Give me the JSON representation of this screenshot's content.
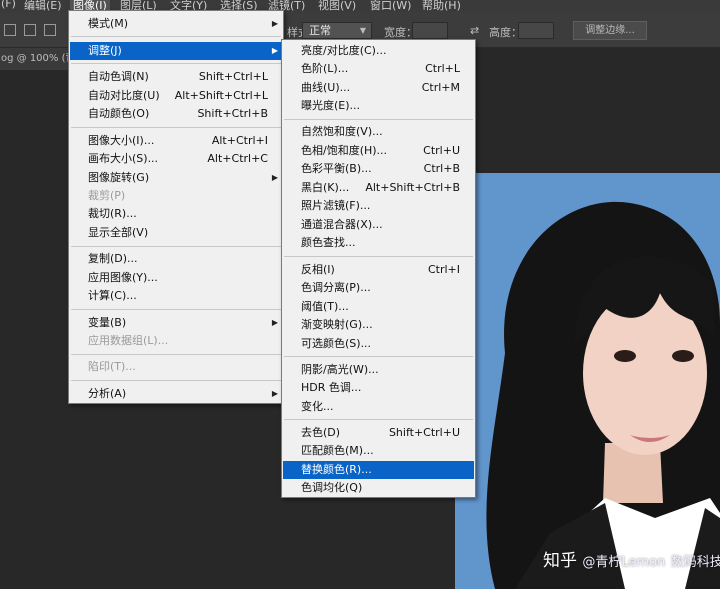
{
  "menubar": {
    "items": [
      "(F)",
      "编辑(E)",
      "图像(I)",
      "图层(L)",
      "文字(Y)",
      "选择(S)",
      "滤镜(T)",
      "视图(V)",
      "窗口(W)",
      "帮助(H)"
    ]
  },
  "options_bar": {
    "style_label": "样式：",
    "style_value": "正常",
    "width_label": "宽度：",
    "height_label": "高度：",
    "refine_edge": "调整边缘..."
  },
  "doc_tab": {
    "title": "og @ 100% (背"
  },
  "main_menu": {
    "items": [
      {
        "label": "模式(M)",
        "shortcut": "",
        "submenu": true,
        "disabled": false,
        "selected": false
      },
      {
        "label": "调整(J)",
        "shortcut": "",
        "submenu": true,
        "disabled": false,
        "selected": true
      },
      {
        "label": "自动色调(N)",
        "shortcut": "Shift+Ctrl+L",
        "submenu": false,
        "disabled": false,
        "selected": false
      },
      {
        "label": "自动对比度(U)",
        "shortcut": "Alt+Shift+Ctrl+L",
        "submenu": false,
        "disabled": false,
        "selected": false
      },
      {
        "label": "自动颜色(O)",
        "shortcut": "Shift+Ctrl+B",
        "submenu": false,
        "disabled": false,
        "selected": false
      },
      {
        "label": "图像大小(I)...",
        "shortcut": "Alt+Ctrl+I",
        "submenu": false,
        "disabled": false,
        "selected": false
      },
      {
        "label": "画布大小(S)...",
        "shortcut": "Alt+Ctrl+C",
        "submenu": false,
        "disabled": false,
        "selected": false
      },
      {
        "label": "图像旋转(G)",
        "shortcut": "",
        "submenu": true,
        "disabled": false,
        "selected": false
      },
      {
        "label": "裁剪(P)",
        "shortcut": "",
        "submenu": false,
        "disabled": true,
        "selected": false
      },
      {
        "label": "裁切(R)...",
        "shortcut": "",
        "submenu": false,
        "disabled": false,
        "selected": false
      },
      {
        "label": "显示全部(V)",
        "shortcut": "",
        "submenu": false,
        "disabled": false,
        "selected": false
      },
      {
        "label": "复制(D)...",
        "shortcut": "",
        "submenu": false,
        "disabled": false,
        "selected": false
      },
      {
        "label": "应用图像(Y)...",
        "shortcut": "",
        "submenu": false,
        "disabled": false,
        "selected": false
      },
      {
        "label": "计算(C)...",
        "shortcut": "",
        "submenu": false,
        "disabled": false,
        "selected": false
      },
      {
        "label": "变量(B)",
        "shortcut": "",
        "submenu": true,
        "disabled": false,
        "selected": false
      },
      {
        "label": "应用数据组(L)...",
        "shortcut": "",
        "submenu": false,
        "disabled": true,
        "selected": false
      },
      {
        "label": "陷印(T)...",
        "shortcut": "",
        "submenu": false,
        "disabled": true,
        "selected": false
      },
      {
        "label": "分析(A)",
        "shortcut": "",
        "submenu": true,
        "disabled": false,
        "selected": false
      }
    ]
  },
  "sub_menu": {
    "items": [
      {
        "label": "亮度/对比度(C)...",
        "shortcut": "",
        "selected": false
      },
      {
        "label": "色阶(L)...",
        "shortcut": "Ctrl+L",
        "selected": false
      },
      {
        "label": "曲线(U)...",
        "shortcut": "Ctrl+M",
        "selected": false
      },
      {
        "label": "曝光度(E)...",
        "shortcut": "",
        "selected": false
      },
      {
        "label": "自然饱和度(V)...",
        "shortcut": "",
        "selected": false
      },
      {
        "label": "色相/饱和度(H)...",
        "shortcut": "Ctrl+U",
        "selected": false
      },
      {
        "label": "色彩平衡(B)...",
        "shortcut": "Ctrl+B",
        "selected": false
      },
      {
        "label": "黑白(K)...",
        "shortcut": "Alt+Shift+Ctrl+B",
        "selected": false
      },
      {
        "label": "照片滤镜(F)...",
        "shortcut": "",
        "selected": false
      },
      {
        "label": "通道混合器(X)...",
        "shortcut": "",
        "selected": false
      },
      {
        "label": "颜色查找...",
        "shortcut": "",
        "selected": false
      },
      {
        "label": "反相(I)",
        "shortcut": "Ctrl+I",
        "selected": false
      },
      {
        "label": "色调分离(P)...",
        "shortcut": "",
        "selected": false
      },
      {
        "label": "阈值(T)...",
        "shortcut": "",
        "selected": false
      },
      {
        "label": "渐变映射(G)...",
        "shortcut": "",
        "selected": false
      },
      {
        "label": "可选颜色(S)...",
        "shortcut": "",
        "selected": false
      },
      {
        "label": "阴影/高光(W)...",
        "shortcut": "",
        "selected": false
      },
      {
        "label": "HDR 色调...",
        "shortcut": "",
        "selected": false
      },
      {
        "label": "变化...",
        "shortcut": "",
        "selected": false
      },
      {
        "label": "去色(D)",
        "shortcut": "Shift+Ctrl+U",
        "selected": false
      },
      {
        "label": "匹配颜色(M)...",
        "shortcut": "",
        "selected": false
      },
      {
        "label": "替换颜色(R)...",
        "shortcut": "",
        "selected": true
      },
      {
        "label": "色调均化(Q)",
        "shortcut": "",
        "selected": false
      }
    ]
  },
  "watermark": {
    "main": "知乎",
    "sub": "@青柠Lemon",
    "brand": "数码科技"
  },
  "colors": {
    "selection": "#0a64c8",
    "menu_bg": "#f0f0f0",
    "workspace": "#282828",
    "photo_bg": "#5b8fc7"
  }
}
